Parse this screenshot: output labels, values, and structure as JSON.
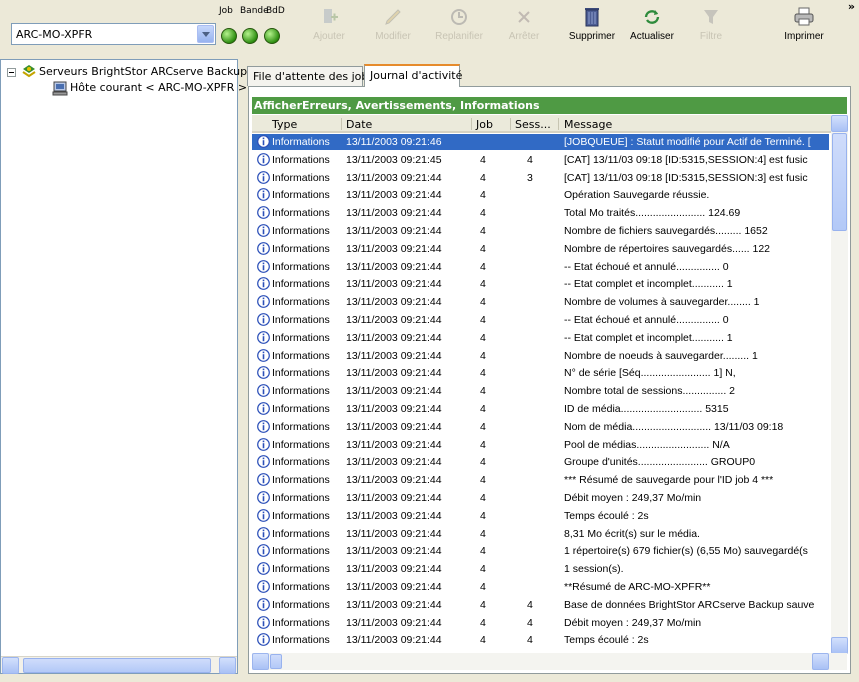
{
  "toolbar": {
    "server_combo_value": "ARC-MO-XPFR",
    "labels": {
      "job": "Job",
      "bande": "Bande",
      "bdd": "BdD"
    },
    "buttons": [
      {
        "label": "Ajouter",
        "enabled": false,
        "icon": "add-job-icon"
      },
      {
        "label": "Modifier",
        "enabled": false,
        "icon": "pencil-icon"
      },
      {
        "label": "Replanifier",
        "enabled": false,
        "icon": "reschedule-icon"
      },
      {
        "label": "Arrêter",
        "enabled": false,
        "icon": "stop-icon"
      },
      {
        "label": "Supprimer",
        "enabled": true,
        "icon": "trash-icon"
      },
      {
        "label": "Actualiser",
        "enabled": true,
        "icon": "refresh-icon"
      },
      {
        "label": "Filtre",
        "enabled": false,
        "icon": "filter-icon"
      },
      {
        "label": "Imprimer",
        "enabled": true,
        "icon": "printer-icon"
      }
    ],
    "overflow": "»"
  },
  "tree": {
    "root": "Serveurs BrightStor ARCserve Backup",
    "child": "Hôte courant < ARC-MO-XPFR >"
  },
  "tabs": [
    {
      "label": "File d'attente des jobs",
      "active": false
    },
    {
      "label": "Journal d'activité",
      "active": true
    }
  ],
  "filter_bar": "AfficherErreurs, Avertissements, Informations",
  "columns": [
    "Type",
    "Date",
    "Job",
    "Sess...",
    "Message"
  ],
  "rows": [
    {
      "type": "Informations",
      "date": "13/11/2003 09:21:46",
      "job": "",
      "sess": "",
      "message": "[JOBQUEUE] : Statut modifié pour Actif de Terminé. [",
      "selected": true
    },
    {
      "type": "Informations",
      "date": "13/11/2003 09:21:45",
      "job": "4",
      "sess": "4",
      "message": "[CAT] 13/11/03 09:18 [ID:5315,SESSION:4] est fusic"
    },
    {
      "type": "Informations",
      "date": "13/11/2003 09:21:44",
      "job": "4",
      "sess": "3",
      "message": "[CAT] 13/11/03 09:18 [ID:5315,SESSION:3] est fusic"
    },
    {
      "type": "Informations",
      "date": "13/11/2003 09:21:44",
      "job": "4",
      "sess": "",
      "message": "Opération Sauvegarde réussie."
    },
    {
      "type": "Informations",
      "date": "13/11/2003 09:21:44",
      "job": "4",
      "sess": "",
      "message": "Total Mo traités........................ 124.69"
    },
    {
      "type": "Informations",
      "date": "13/11/2003 09:21:44",
      "job": "4",
      "sess": "",
      "message": "Nombre de fichiers sauvegardés......... 1652"
    },
    {
      "type": "Informations",
      "date": "13/11/2003 09:21:44",
      "job": "4",
      "sess": "",
      "message": "Nombre de répertoires sauvegardés...... 122"
    },
    {
      "type": "Informations",
      "date": "13/11/2003 09:21:44",
      "job": "4",
      "sess": "",
      "message": "-- Etat échoué et annulé............... 0"
    },
    {
      "type": "Informations",
      "date": "13/11/2003 09:21:44",
      "job": "4",
      "sess": "",
      "message": "-- Etat complet et incomplet........... 1"
    },
    {
      "type": "Informations",
      "date": "13/11/2003 09:21:44",
      "job": "4",
      "sess": "",
      "message": "Nombre de volumes à sauvegarder........ 1"
    },
    {
      "type": "Informations",
      "date": "13/11/2003 09:21:44",
      "job": "4",
      "sess": "",
      "message": "-- Etat échoué et annulé............... 0"
    },
    {
      "type": "Informations",
      "date": "13/11/2003 09:21:44",
      "job": "4",
      "sess": "",
      "message": "-- Etat complet et incomplet........... 1"
    },
    {
      "type": "Informations",
      "date": "13/11/2003 09:21:44",
      "job": "4",
      "sess": "",
      "message": "Nombre de noeuds à sauvegarder......... 1"
    },
    {
      "type": "Informations",
      "date": "13/11/2003 09:21:44",
      "job": "4",
      "sess": "",
      "message": "N° de série [Séq........................ 1]                    N,"
    },
    {
      "type": "Informations",
      "date": "13/11/2003 09:21:44",
      "job": "4",
      "sess": "",
      "message": "Nombre total de sessions............... 2"
    },
    {
      "type": "Informations",
      "date": "13/11/2003 09:21:44",
      "job": "4",
      "sess": "",
      "message": "ID de média............................ 5315"
    },
    {
      "type": "Informations",
      "date": "13/11/2003 09:21:44",
      "job": "4",
      "sess": "",
      "message": "Nom de média........................... 13/11/03 09:18"
    },
    {
      "type": "Informations",
      "date": "13/11/2003 09:21:44",
      "job": "4",
      "sess": "",
      "message": "Pool de médias......................... N/A"
    },
    {
      "type": "Informations",
      "date": "13/11/2003 09:21:44",
      "job": "4",
      "sess": "",
      "message": "Groupe d'unités........................ GROUP0"
    },
    {
      "type": "Informations",
      "date": "13/11/2003 09:21:44",
      "job": "4",
      "sess": "",
      "message": "*** Résumé de sauvegarde pour l'ID job 4 ***"
    },
    {
      "type": "Informations",
      "date": "13/11/2003 09:21:44",
      "job": "4",
      "sess": "",
      "message": "Débit moyen : 249,37 Mo/min"
    },
    {
      "type": "Informations",
      "date": "13/11/2003 09:21:44",
      "job": "4",
      "sess": "",
      "message": "Temps écoulé : 2s"
    },
    {
      "type": "Informations",
      "date": "13/11/2003 09:21:44",
      "job": "4",
      "sess": "",
      "message": "8,31 Mo écrit(s) sur le média."
    },
    {
      "type": "Informations",
      "date": "13/11/2003 09:21:44",
      "job": "4",
      "sess": "",
      "message": "1 répertoire(s) 679 fichier(s) (6,55 Mo) sauvegardé(s"
    },
    {
      "type": "Informations",
      "date": "13/11/2003 09:21:44",
      "job": "4",
      "sess": "",
      "message": "1 session(s)."
    },
    {
      "type": "Informations",
      "date": "13/11/2003 09:21:44",
      "job": "4",
      "sess": "",
      "message": "**Résumé de ARC-MO-XPFR**"
    },
    {
      "type": "Informations",
      "date": "13/11/2003 09:21:44",
      "job": "4",
      "sess": "4",
      "message": "Base de données BrightStor ARCserve Backup sauve"
    },
    {
      "type": "Informations",
      "date": "13/11/2003 09:21:44",
      "job": "4",
      "sess": "4",
      "message": "Débit moyen : 249,37 Mo/min"
    },
    {
      "type": "Informations",
      "date": "13/11/2003 09:21:44",
      "job": "4",
      "sess": "4",
      "message": "Temps écoulé : 2s"
    }
  ],
  "colors": {
    "filter_bar": "#4f9a44",
    "selection": "#316ac5",
    "status_lamp": "#2f8f12"
  }
}
